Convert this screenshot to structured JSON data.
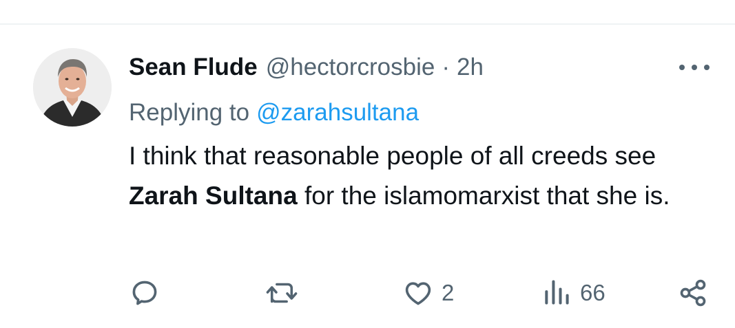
{
  "tweet": {
    "display_name": "Sean Flude",
    "handle": "@hectorcrosbie",
    "separator": "·",
    "time": "2h",
    "replying_prefix": "Replying to",
    "replying_handle": "@zarahsultana",
    "text_part1": "I think that reasonable people of all creeds see ",
    "text_bold": "Zarah Sultana",
    "text_part2": " for the islamomarxist that she is.",
    "icons": {
      "avatar": "profile-photo",
      "more": "more-horizontal-icon",
      "reply": "reply-icon",
      "retweet": "retweet-icon",
      "like": "heart-icon",
      "views": "views-chart-icon",
      "share": "share-icon"
    }
  },
  "actions": {
    "reply_count": "",
    "retweet_count": "",
    "like_count": "2",
    "views_count": "66"
  },
  "colors": {
    "text_primary": "#0f1419",
    "text_secondary": "#536471",
    "link": "#1d9bf0",
    "divider": "#eff3f4"
  }
}
